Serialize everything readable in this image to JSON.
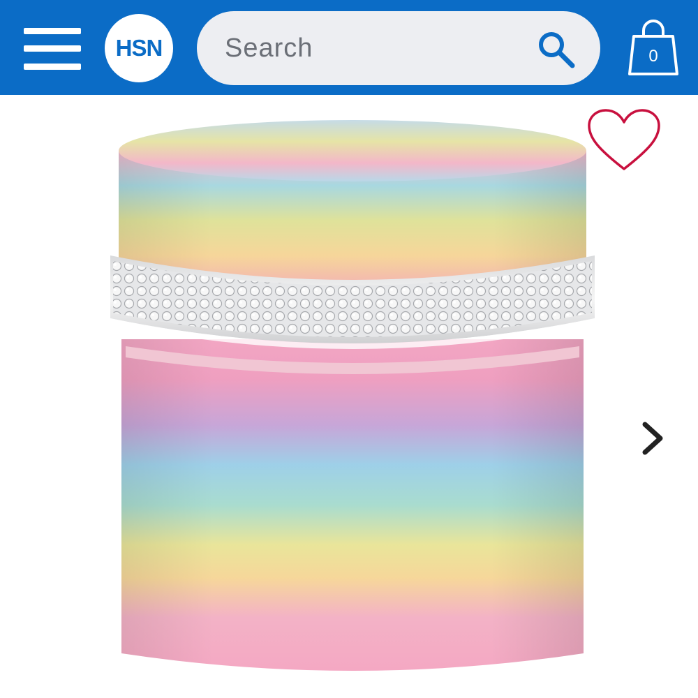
{
  "header": {
    "background_color": "#0b6cc6",
    "menu_icon": "hamburger-menu-icon",
    "logo_text": "HSN",
    "search": {
      "placeholder": "Search",
      "value": "",
      "icon": "search-icon"
    },
    "bag": {
      "icon": "shopping-bag-icon",
      "count": "0"
    }
  },
  "product": {
    "image_description_icon": "rainbow-glitter-rhinestone-jar",
    "favorite_icon": "heart-outline-icon",
    "favorite_color": "#c8103e",
    "next_icon": "chevron-right-icon"
  }
}
